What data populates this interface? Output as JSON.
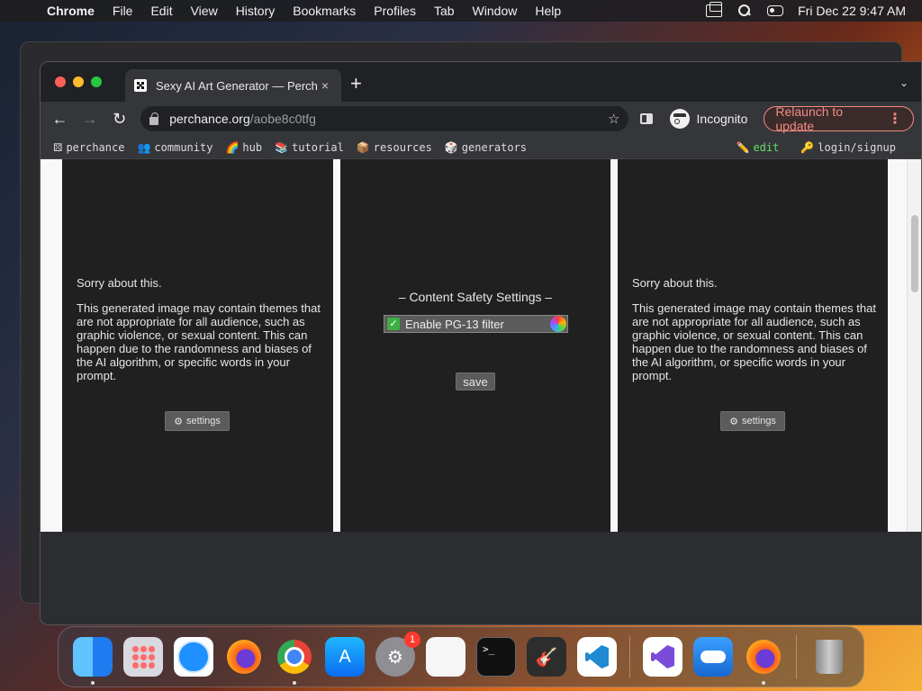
{
  "menubar": {
    "app_name": "Chrome",
    "items": [
      "File",
      "Edit",
      "View",
      "History",
      "Bookmarks",
      "Profiles",
      "Tab",
      "Window",
      "Help"
    ],
    "datetime": "Fri Dec 22  9:47 AM"
  },
  "browser": {
    "tab_title": "Sexy AI Art Generator — Perch",
    "tab_close": "×",
    "new_tab": "+",
    "url_host": "perchance.org",
    "url_path": "/aobe8c0tfg",
    "profile_label": "Incognito",
    "relaunch_label": "Relaunch to update",
    "kebab": "⋮"
  },
  "bookmarks": {
    "left": [
      {
        "icon": "⚄",
        "label": "perchance"
      },
      {
        "icon": "👥",
        "label": "community"
      },
      {
        "icon": "🌈",
        "label": "hub"
      },
      {
        "icon": "📚",
        "label": "tutorial"
      },
      {
        "icon": "📦",
        "label": "resources"
      },
      {
        "icon": "🎲",
        "label": "generators"
      }
    ],
    "right": [
      {
        "icon": "✏️",
        "label": "edit"
      },
      {
        "icon": "🔑",
        "label": "login/signup"
      }
    ]
  },
  "page": {
    "notice_title": "Sorry about this.",
    "notice_body": "This generated image may contain themes that are not appropriate for all audience, such as graphic violence, or sexual content. This can happen due to the randomness and biases of the AI algorithm, or specific words in your prompt.",
    "settings_label": "settings",
    "content_safety_title": "– Content Safety Settings –",
    "filter_label": "Enable PG-13 filter",
    "filter_checked": true,
    "save_label": "save"
  },
  "dock": {
    "apps": [
      "Finder",
      "Launchpad",
      "Safari",
      "Firefox",
      "Chrome",
      "App Store",
      "System Preferences",
      "TextEdit",
      "Terminal",
      "GarageBand",
      "Visual Studio Code"
    ],
    "recent": [
      "Visual Studio",
      "Weather",
      "Firefox"
    ],
    "sysprefs_badge": "1",
    "terminal_prompt": ">_"
  }
}
